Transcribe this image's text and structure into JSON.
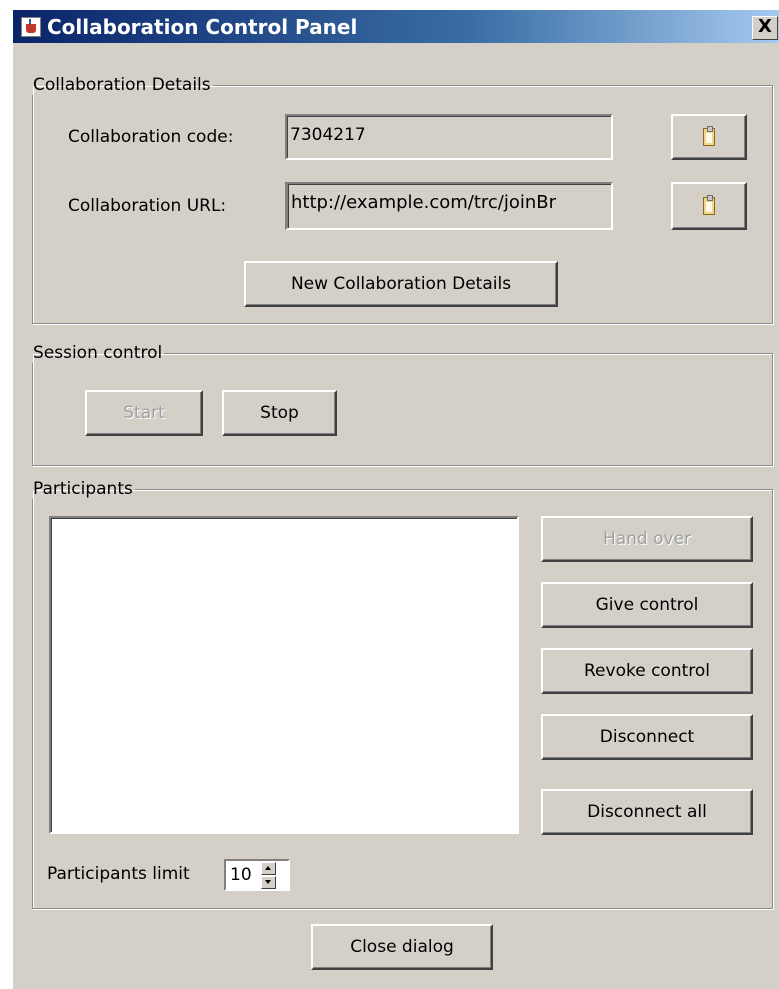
{
  "window": {
    "title": "Collaboration Control Panel",
    "close_label": "X"
  },
  "collaboration_details": {
    "legend": "Collaboration Details",
    "code_label": "Collaboration code:",
    "code_value": "7304217",
    "url_label": "Collaboration URL:",
    "url_value": "http://example.com/trc/joinBr",
    "copy_icon": "clipboard-icon",
    "new_button": "New Collaboration Details"
  },
  "session_control": {
    "legend": "Session control",
    "start_label": "Start",
    "stop_label": "Stop"
  },
  "participants": {
    "legend": "Participants",
    "hand_over": "Hand over",
    "give_control": "Give control",
    "revoke_control": "Revoke control",
    "disconnect": "Disconnect",
    "disconnect_all": "Disconnect all",
    "limit_label": "Participants limit",
    "limit_value": "10"
  },
  "footer": {
    "close_dialog": "Close dialog"
  }
}
